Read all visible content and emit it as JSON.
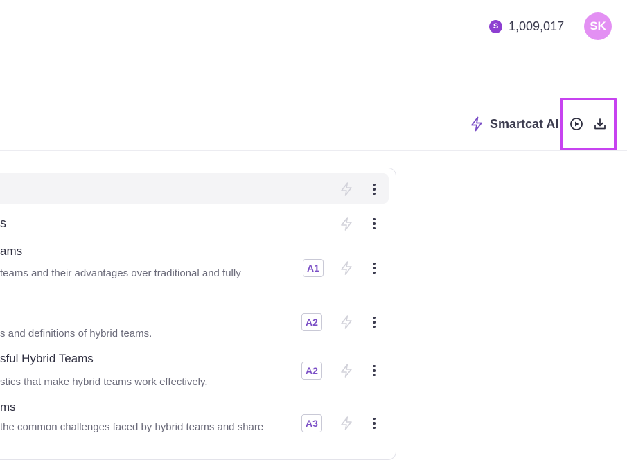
{
  "header": {
    "credits": {
      "icon": "S",
      "amount": "1,009,017"
    },
    "avatar": {
      "initials": "SK"
    }
  },
  "toolbar": {
    "smartcat_ai_label": "Smartcat AI",
    "play_icon": "play-circle-icon",
    "download_icon": "download-icon"
  },
  "outline": {
    "rows": [
      {
        "title": "",
        "desc": "",
        "badge": ""
      },
      {
        "title": "s",
        "desc": "",
        "badge": ""
      },
      {
        "title": "ams",
        "desc": "teams and their advantages over traditional and fully",
        "badge": "A1"
      },
      {
        "title": "",
        "desc": "s and definitions of hybrid teams.",
        "badge": "A2"
      },
      {
        "title": "sful Hybrid Teams",
        "desc": "stics that make hybrid teams work effectively.",
        "badge": "A2"
      },
      {
        "title": "ms",
        "desc": "the common challenges faced by hybrid teams and share",
        "badge": "A3"
      }
    ]
  },
  "colors": {
    "accent": "#c743f0",
    "avatar": "#e390f3",
    "credit": "#8d3fd1",
    "badge_text": "#7b4fc6"
  }
}
